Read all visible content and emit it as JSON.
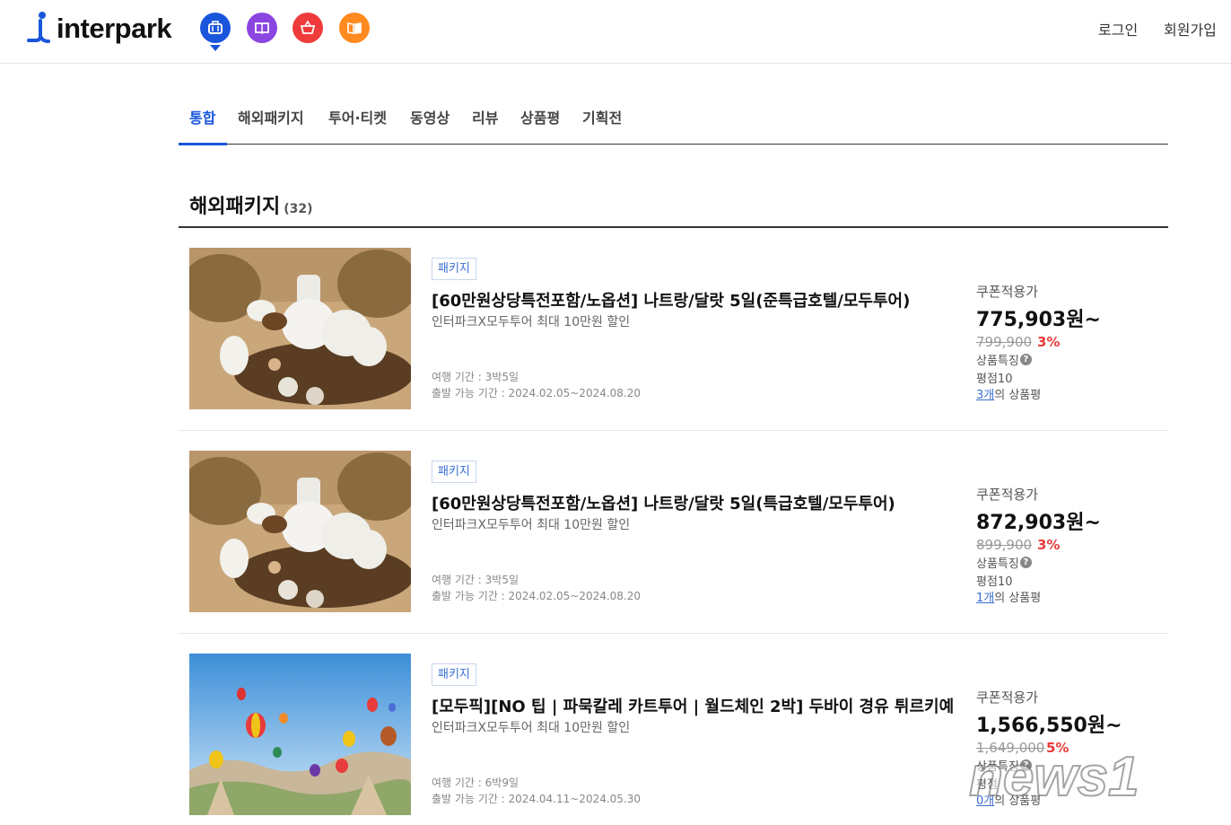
{
  "header": {
    "logo_text": "interpark",
    "services": [
      {
        "icon": "suitcase-icon",
        "color": "#1a56db"
      },
      {
        "icon": "book-icon",
        "color": "#8b46e0"
      },
      {
        "icon": "basket-icon",
        "color": "#ef3b3b"
      },
      {
        "icon": "open-book-icon",
        "color": "#ff8a1f"
      }
    ],
    "login_label": "로그인",
    "signup_label": "회원가입"
  },
  "tabs": [
    {
      "label": "통합",
      "active": true
    },
    {
      "label": "해외패키지"
    },
    {
      "label": "투어·티켓"
    },
    {
      "label": "동영상"
    },
    {
      "label": "리뷰"
    },
    {
      "label": "상품평"
    },
    {
      "label": "기획전"
    }
  ],
  "section": {
    "title": "해외패키지",
    "count": "(32)"
  },
  "items": [
    {
      "badge": "패키지",
      "title": "[60만원상당특전포함/노옵션] 나트랑/달랏 5일(준특급호텔/모두투어)",
      "subtitle": "인터파크X모두투어 최대 10만원 할인",
      "duration": "여행 기간 : 3박5일",
      "departure": "출발 가능 기간 : 2024.02.05~2024.08.20",
      "coupon_label": "쿠폰적용가",
      "price": "775,903원~",
      "original_price": "799,900",
      "discount": "3%",
      "feature_label": "상품특징",
      "rating": "평점10",
      "review_count": "3개",
      "review_suffix": "의 상품평"
    },
    {
      "badge": "패키지",
      "title": "[60만원상당특전포함/노옵션] 나트랑/달랏 5일(특급호텔/모두투어)",
      "subtitle": "인터파크X모두투어 최대 10만원 할인",
      "duration": "여행 기간 : 3박5일",
      "departure": "출발 가능 기간 : 2024.02.05~2024.08.20",
      "coupon_label": "쿠폰적용가",
      "price": "872,903원~",
      "original_price": "899,900",
      "discount": "3%",
      "feature_label": "상품특징",
      "rating": "평점10",
      "review_count": "1개",
      "review_suffix": "의 상품평"
    },
    {
      "badge": "패키지",
      "title": "[모두픽][NO 팁 | 파묵칼레 카트투어 | 월드체인 2박] 두바이 경유 튀르키예",
      "subtitle": "인터파크X모두투어 최대 10만원 할인",
      "duration": "여행 기간 : 6박9일",
      "departure": "출발 가능 기간 : 2024.04.11~2024.05.30",
      "coupon_label": "쿠폰적용가",
      "price": "1,566,550원~",
      "original_price": "1,649,000",
      "discount": "5%",
      "feature_label": "상품특징",
      "rating": "평점",
      "review_count": "0개",
      "review_suffix": "의 상품평"
    }
  ],
  "watermark": "news1"
}
